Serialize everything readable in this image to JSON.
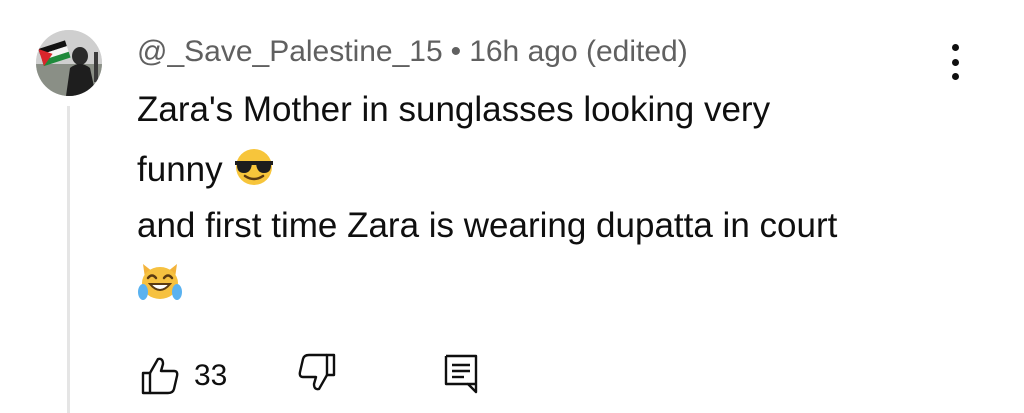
{
  "comment": {
    "author": "@_Save_Palestine_15",
    "separator": "•",
    "time": "16h ago (edited)",
    "lines": [
      "Zara's Mother in sunglasses looking very",
      "funny",
      "and first time Zara is wearing dupatta in court"
    ],
    "emojis": [
      "smiling-face-with-sunglasses",
      "grinning-cat-with-tears-of-joy"
    ]
  },
  "actions": {
    "like_count": "33"
  },
  "icons": {
    "avatar": "avatar-flag-photo",
    "menu": "vertical-dots-icon",
    "like": "thumbs-up-icon",
    "dislike": "thumbs-down-icon",
    "reply": "comment-icon"
  },
  "colors": {
    "text": "#0f0f0f",
    "meta": "#606060",
    "thread": "#e5e5e5"
  }
}
